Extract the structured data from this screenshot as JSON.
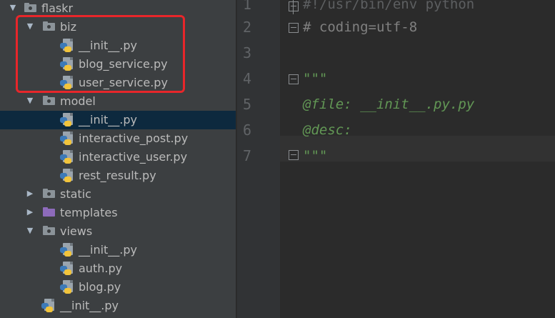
{
  "tree": {
    "items": [
      {
        "label": "flaskr",
        "type": "folder",
        "expanded": true,
        "depth": 0
      },
      {
        "label": "biz",
        "type": "folder",
        "expanded": true,
        "depth": 1
      },
      {
        "label": "__init__.py",
        "type": "python",
        "depth": 2
      },
      {
        "label": "blog_service.py",
        "type": "python",
        "depth": 2
      },
      {
        "label": "user_service.py",
        "type": "python",
        "depth": 2
      },
      {
        "label": "model",
        "type": "folder",
        "expanded": true,
        "depth": 1
      },
      {
        "label": "__init__.py",
        "type": "python",
        "depth": 2,
        "selected": true
      },
      {
        "label": "interactive_post.py",
        "type": "python",
        "depth": 2
      },
      {
        "label": "interactive_user.py",
        "type": "python",
        "depth": 2
      },
      {
        "label": "rest_result.py",
        "type": "python",
        "depth": 2
      },
      {
        "label": "static",
        "type": "folder",
        "expanded": false,
        "depth": 1
      },
      {
        "label": "templates",
        "type": "folder-purple",
        "expanded": false,
        "depth": 1
      },
      {
        "label": "views",
        "type": "folder",
        "expanded": true,
        "depth": 1
      },
      {
        "label": "__init__.py",
        "type": "python",
        "depth": 2
      },
      {
        "label": "auth.py",
        "type": "python",
        "depth": 2
      },
      {
        "label": "blog.py",
        "type": "python",
        "depth": 2
      },
      {
        "label": "__init__.py",
        "type": "python",
        "depth": 1
      }
    ]
  },
  "editor": {
    "lines": [
      {
        "number": "1",
        "text": "#!/usr/bin/env python",
        "style": "faded"
      },
      {
        "number": "2",
        "text": "# coding=utf-8",
        "style": "comment"
      },
      {
        "number": "3",
        "text": "",
        "style": "comment"
      },
      {
        "number": "4",
        "text": "\"\"\"",
        "style": "doc"
      },
      {
        "number": "5",
        "text": "@file: __init__.py.py",
        "style": "doc"
      },
      {
        "number": "6",
        "text": "@desc:",
        "style": "doc"
      },
      {
        "number": "7",
        "text": "\"\"\"",
        "style": "doc"
      }
    ]
  },
  "colors": {
    "highlight_box": "#e8262a",
    "selection": "#0d293e",
    "docstring": "#629755"
  }
}
